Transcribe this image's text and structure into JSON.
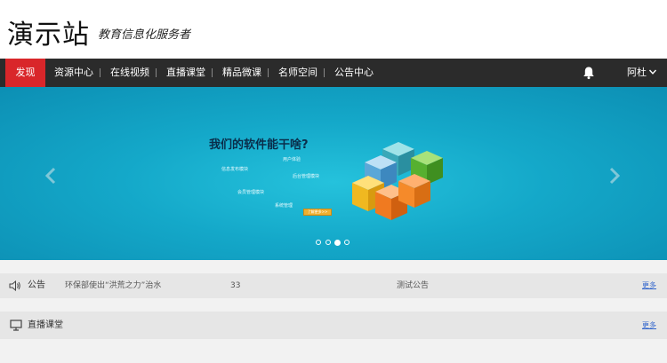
{
  "header": {
    "logo": "演示站",
    "slogan": "教育信息化服务者"
  },
  "nav": {
    "items": [
      {
        "label": "发现",
        "active": true
      },
      {
        "label": "资源中心"
      },
      {
        "label": "在线视频"
      },
      {
        "label": "直播课堂"
      },
      {
        "label": "精品微课"
      },
      {
        "label": "名师空间"
      },
      {
        "label": "公告中心"
      }
    ],
    "user": "阿杜",
    "icons": {
      "notifications": "bell-icon",
      "user_menu": "chevron-down-icon"
    }
  },
  "banner": {
    "title": "我们的软件能干啥?",
    "features": [
      "用户体验",
      "信息发布模块",
      "后台管理模块",
      "会员管理模块",
      "系统管理"
    ],
    "cta": "了解更多>>",
    "slides_count": 4,
    "active_slide": 3,
    "colors": {
      "background": "#14a8c9"
    }
  },
  "notice": {
    "label": "公告",
    "items": [
      "环保部使出“洪荒之力”治水",
      "33",
      "测试公告"
    ],
    "more": "更多",
    "icon": "speaker-icon"
  },
  "live": {
    "label": "直播课堂",
    "more": "更多",
    "icon": "monitor-icon"
  },
  "colors": {
    "accent": "#d9262a",
    "nav_bg": "#2b2b2b"
  }
}
